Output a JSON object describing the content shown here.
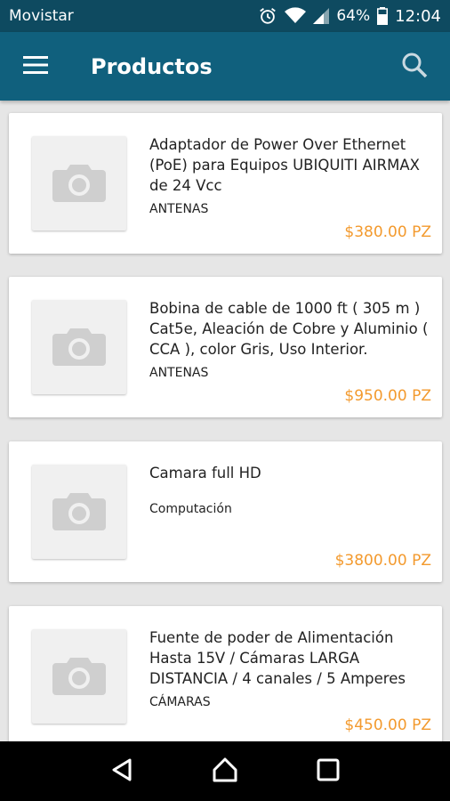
{
  "status": {
    "carrier": "Movistar",
    "battery": "64%",
    "time": "12:04"
  },
  "header": {
    "title": "Productos",
    "menu_icon": "menu-icon",
    "search_icon": "search-icon"
  },
  "products": [
    {
      "name": "Adaptador de Power Over Ethernet (PoE) para Equipos UBIQUITI AIRMAX de 24 Vcc",
      "category": "ANTENAS",
      "price": "$380.00 PZ"
    },
    {
      "name": "Bobina de cable de 1000 ft ( 305 m ) Cat5e, Aleación de Cobre y Aluminio ( CCA ), color Gris, Uso Interior.",
      "category": "ANTENAS",
      "price": "$950.00 PZ"
    },
    {
      "name": "Camara full HD",
      "category": "Computación",
      "price": "$3800.00 PZ"
    },
    {
      "name": "Fuente de poder de Alimentación Hasta 15V / Cámaras LARGA DISTANCIA / 4 canales / 5 Amperes",
      "category": "CÁMARAS",
      "price": "$450.00 PZ"
    }
  ],
  "colors": {
    "status_bar": "#0e4a60",
    "app_bar": "#10607d",
    "price": "#f39a2e",
    "background": "#e6e6e6"
  }
}
